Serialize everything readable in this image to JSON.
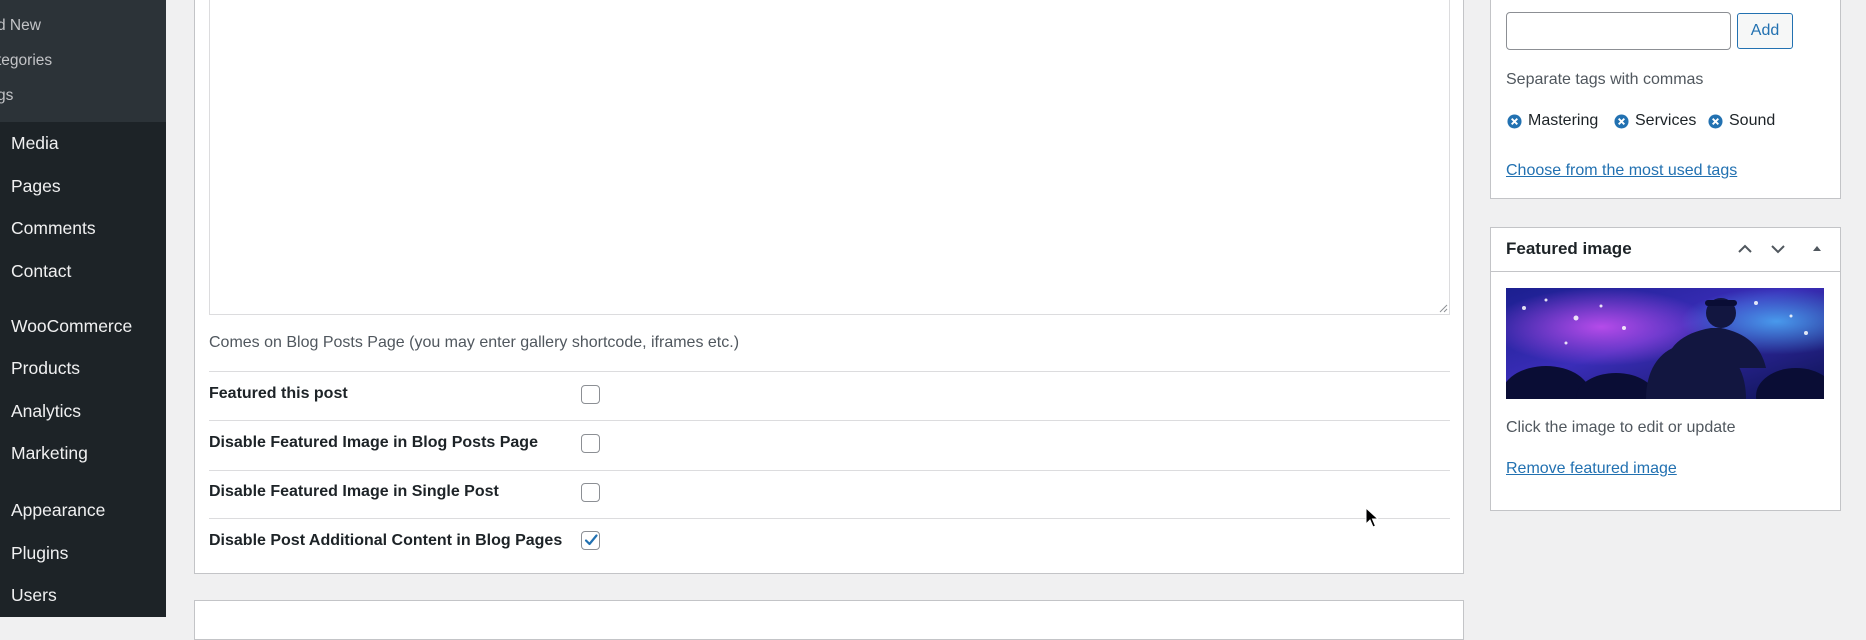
{
  "sidebar": {
    "submenu": [
      "d New",
      "tegories",
      "gs"
    ],
    "items": [
      "Media",
      "Pages",
      "Comments",
      "Contact",
      "WooCommerce",
      "Products",
      "Analytics",
      "Marketing",
      "Appearance",
      "Plugins",
      "Users"
    ]
  },
  "editor": {
    "description": "Comes on Blog Posts Page (you may enter gallery shortcode, iframes etc.)",
    "options": [
      {
        "label": "Featured this post",
        "checked": false
      },
      {
        "label": "Disable Featured Image in Blog Posts Page",
        "checked": false
      },
      {
        "label": "Disable Featured Image in Single Post",
        "checked": false
      },
      {
        "label": "Disable Post Additional Content in Blog Pages",
        "checked": true
      }
    ]
  },
  "tags": {
    "input_value": "",
    "add_label": "Add",
    "hint": "Separate tags with commas",
    "items": [
      "Mastering",
      "Services",
      "Sound"
    ],
    "most_used_link": "Choose from the most used tags"
  },
  "featured_image": {
    "title": "Featured image",
    "note": "Click the image to edit or update",
    "remove_link": "Remove featured image"
  },
  "colors": {
    "accent": "#2271b1",
    "sidebar_bg": "#1d2327",
    "submenu_bg": "#2c3338"
  }
}
